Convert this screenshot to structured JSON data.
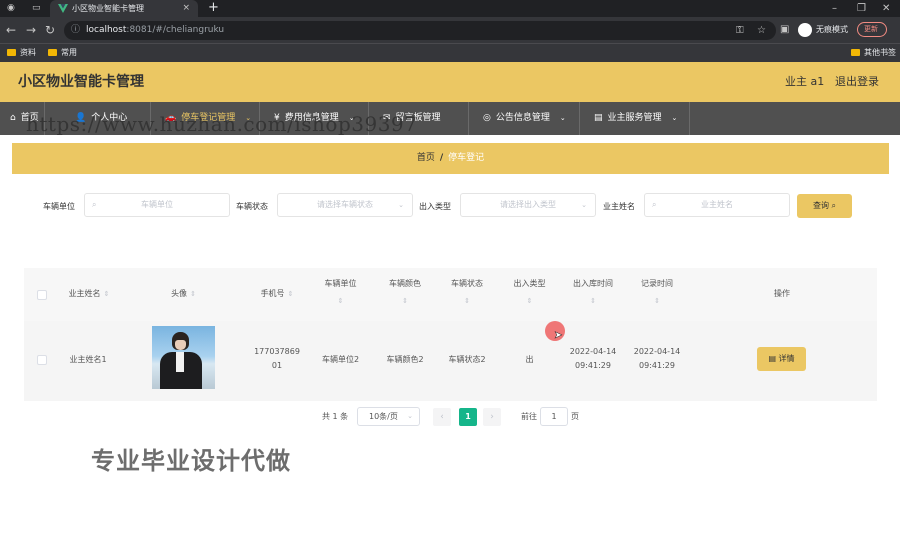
{
  "browser": {
    "tab_title": "小区物业智能卡管理",
    "tab_close": "×",
    "new_tab": "+",
    "address_host": "localhost",
    "address_path": ":8081/#/cheliangruku",
    "incognito_label": "无痕模式",
    "update_label": "更新",
    "bookmarks": [
      "资料",
      "常用"
    ],
    "other_bookmarks": "其他书签"
  },
  "header": {
    "title": "小区物业智能卡管理",
    "user": "业主 a1",
    "logout": "退出登录"
  },
  "nav": {
    "items": [
      {
        "label": "首页",
        "icon": "home-icon"
      },
      {
        "label": "个人中心",
        "icon": "user-icon"
      },
      {
        "label": "停车登记管理",
        "icon": "car-icon"
      },
      {
        "label": "费用信息管理",
        "icon": "money-icon"
      },
      {
        "label": "留言板管理",
        "icon": "message-icon"
      },
      {
        "label": "公告信息管理",
        "icon": "bulletin-icon"
      },
      {
        "label": "业主服务管理",
        "icon": "service-icon"
      }
    ]
  },
  "watermark_url": "https://www.huzhan.com/ishop39397",
  "breadcrumb": {
    "home": "首页",
    "separator": "/",
    "current": "停车登记"
  },
  "search": {
    "unit_label": "车辆单位",
    "unit_placeholder": "车辆单位",
    "status_label": "车辆状态",
    "status_placeholder": "请选择车辆状态",
    "type_label": "出入类型",
    "type_placeholder": "请选择出入类型",
    "owner_label": "业主姓名",
    "owner_placeholder": "业主姓名",
    "query_button": "查询"
  },
  "table": {
    "columns": [
      "业主姓名",
      "头像",
      "手机号",
      "车辆单位",
      "车辆颜色",
      "车辆状态",
      "出入类型",
      "出入库时间",
      "记录时间",
      "操作"
    ],
    "rows": [
      {
        "owner": "业主姓名1",
        "phone_line1": "177037869",
        "phone_line2": "01",
        "unit": "车辆单位2",
        "color": "车辆颜色2",
        "status": "车辆状态2",
        "io_type": "出",
        "io_time_date": "2022-04-14",
        "io_time_clock": "09:41:29",
        "record_date": "2022-04-14",
        "record_clock": "09:41:29",
        "detail_button": "详情"
      }
    ]
  },
  "pagination": {
    "total": "共 1 条",
    "page_size": "10条/页",
    "current_page": "1",
    "goto_label": "前往",
    "goto_value": "1",
    "page_suffix": "页"
  },
  "promo_text": "专业毕业设计代做",
  "colors": {
    "accent": "#ebc763",
    "nav_bg": "#505050",
    "page_active": "#15b58a"
  }
}
